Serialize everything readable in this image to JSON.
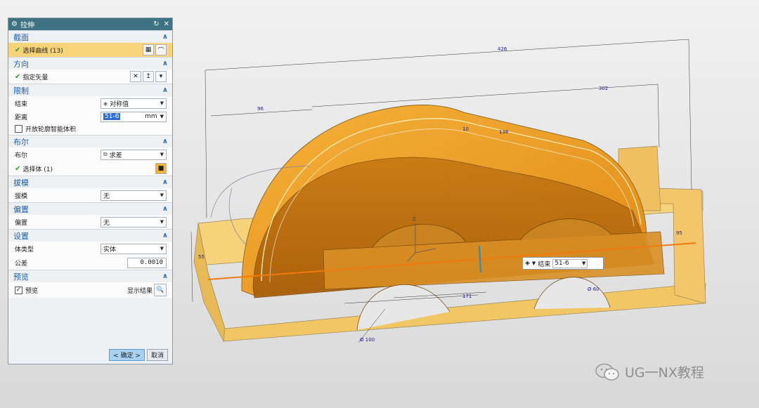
{
  "dialog": {
    "title": "拉伸",
    "sections": {
      "section": {
        "header": "截面",
        "select_curve": "选择曲线 (13)"
      },
      "direction": {
        "header": "方向",
        "specify_vector": "指定矢量"
      },
      "limits": {
        "header": "限制",
        "end_label": "结束",
        "end_value": "对称值",
        "distance_label": "距离",
        "distance_value": "51-6",
        "distance_unit": "mm",
        "open_profile_label": "开放轮廓智能体积"
      },
      "boolean": {
        "header": "布尔",
        "boolean_label": "布尔",
        "boolean_value": "求差",
        "select_body": "选择体 (1)"
      },
      "draft": {
        "header": "拔模",
        "draft_label": "拔模",
        "draft_value": "无"
      },
      "offset": {
        "header": "偏置",
        "offset_label": "偏置",
        "offset_value": "无"
      },
      "settings": {
        "header": "设置",
        "body_type_label": "体类型",
        "body_type_value": "实体",
        "tolerance_label": "公差",
        "tolerance_value": "0.0010"
      },
      "preview": {
        "header": "预览",
        "preview_label": "预览",
        "show_result_label": "显示结果"
      }
    },
    "buttons": {
      "ok": "< 确定 >",
      "cancel": "取消"
    }
  },
  "float_control": {
    "label": "结束",
    "value": "51-6"
  },
  "dimensions": {
    "d_426": "426",
    "d_302": "302",
    "d_96": "96",
    "d_138": "138",
    "d_171": "171",
    "d_100": "Ø 100",
    "d_60": "Ø 60",
    "d_55": "55",
    "d_10": "10",
    "d_95": "95"
  },
  "axis_label": "Z",
  "watermark": "UG一NX教程",
  "colors": {
    "title_bar": "#3f7384",
    "section_header": "#1b5fae",
    "highlight_row": "#f7d37a",
    "part_orange": "#f0a22a",
    "part_light": "#f5cf6e",
    "dimension": "#1a1aa0"
  }
}
